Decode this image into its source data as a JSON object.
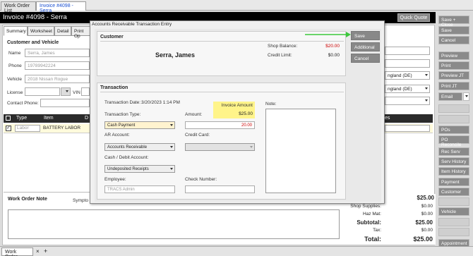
{
  "top_tabs": [
    "Work Order List",
    "Invoice #4098 - Serra"
  ],
  "header": {
    "title": "Invoice #4098 - Serra",
    "quick_quote": "Quick Quote"
  },
  "subtabs": [
    "Summary",
    "Worksheet",
    "Detail",
    "Print Op"
  ],
  "customer_vehicle": {
    "section_title": "Customer and Vehicle",
    "name_label": "Name",
    "name_value": "Serra, James",
    "phone_label": "Phone",
    "phone_value": "19789942224",
    "vehicle_label": "Vehicle",
    "vehicle_value": "2018 Nissan Rogue",
    "license_label": "License",
    "vin_label": "VIN",
    "contact_label": "Contact Phone:"
  },
  "grid": {
    "headers": [
      "Type",
      "Item",
      "D"
    ],
    "rows": [
      {
        "type": "Labor",
        "item": "BATTERY LABOR"
      }
    ],
    "right_header": "es"
  },
  "right_fields": {
    "dropdown1": "ngland (DE)",
    "dropdown2": "ngland (DE)"
  },
  "work_order_note": {
    "title": "Work Order Note",
    "symptom_label": "Sympto"
  },
  "sidebar": {
    "save_close": "Save + Close",
    "save": "Save",
    "cancel": "Cancel",
    "preview": "Preview",
    "print": "Print",
    "preview_jt": "Preview JT",
    "print_jt": "Print JT",
    "email": "Email",
    "pos": "POs",
    "po_reconcile": "PO Reconcile",
    "rec_serv": "Rec Serv",
    "serv_history": "Serv History",
    "item_history": "Item History",
    "payment": "Payment",
    "customer": "Customer",
    "vehicle": "Vehicle",
    "appointment": "Appointment"
  },
  "totals": {
    "top_value": "$25.00",
    "shop_supplies_label": "Shop Supplies:",
    "shop_supplies": "$0.00",
    "haz_mat_label": "Haz Mat:",
    "haz_mat": "$0.00",
    "subtotal_label": "Subtotal:",
    "subtotal": "$25.00",
    "tax_label": "Tax:",
    "tax": "$0.00",
    "total_label": "Total:",
    "total": "$25.00"
  },
  "bottom_tabs": {
    "work_order": "Work Order",
    "close": "×",
    "add": "+"
  },
  "dialog": {
    "title": "Accounts Receivable Transaction Entry",
    "customer_section": "Customer",
    "customer_name": "Serra, James",
    "shop_balance_label": "Shop Balance:",
    "shop_balance": "$20.00",
    "credit_limit_label": "Credit Limit:",
    "credit_limit": "$0.00",
    "save": "Save",
    "additional": "Additional",
    "cancel": "Cancel",
    "transaction_section": "Transaction",
    "transaction_date_label": "Transaction Date:",
    "transaction_date": "3/20/2023 1:14 PM",
    "invoice_amount_label": "Invoice Amount",
    "invoice_amount": "$25.00",
    "transaction_type_label": "Transaction Type:",
    "transaction_type": "Cash Payment",
    "amount_label": "Amount:",
    "amount": "20.00",
    "ar_account_label": "AR Account:",
    "ar_account": "Accounts Receivable",
    "credit_card_label": "Credit Card:",
    "cash_debit_label": "Cash / Debit Account:",
    "cash_debit": "Undeposited Receipts",
    "employee_label": "Employee:",
    "employee": "TRACS Admin",
    "check_number_label": "Check Number:",
    "note_label": "Note:"
  },
  "colors": {
    "accent_arrow": "#3cc83c",
    "highlight": "#fff48a",
    "balance_red": "#cc0000"
  }
}
